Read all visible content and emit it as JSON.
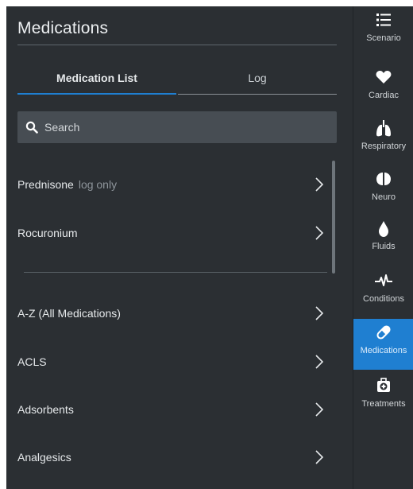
{
  "main": {
    "title": "Medications",
    "tabs": [
      {
        "label": "Medication List",
        "active": true
      },
      {
        "label": "Log",
        "active": false
      }
    ],
    "search": {
      "placeholder": "Search",
      "value": ""
    },
    "recent_items": [
      {
        "label": "Prednisone",
        "sub": "log only"
      },
      {
        "label": "Rocuronium",
        "sub": ""
      }
    ],
    "categories": [
      {
        "label": "A-Z (All Medications)"
      },
      {
        "label": "ACLS"
      },
      {
        "label": "Adsorbents"
      },
      {
        "label": "Analgesics"
      }
    ]
  },
  "nav": {
    "items": [
      {
        "label": "Scenario",
        "icon": "list-icon"
      },
      {
        "label": "Cardiac",
        "icon": "heart-icon"
      },
      {
        "label": "Respiratory",
        "icon": "lungs-icon"
      },
      {
        "label": "Neuro",
        "icon": "brain-icon"
      },
      {
        "label": "Fluids",
        "icon": "droplet-icon"
      },
      {
        "label": "Conditions",
        "icon": "pulse-icon"
      },
      {
        "label": "Medications",
        "icon": "pill-icon",
        "active": true
      },
      {
        "label": "Treatments",
        "icon": "medkit-icon"
      }
    ]
  },
  "colors": {
    "background": "#2b2f33",
    "accent": "#1f7fd1",
    "search_bg": "#474d53"
  }
}
